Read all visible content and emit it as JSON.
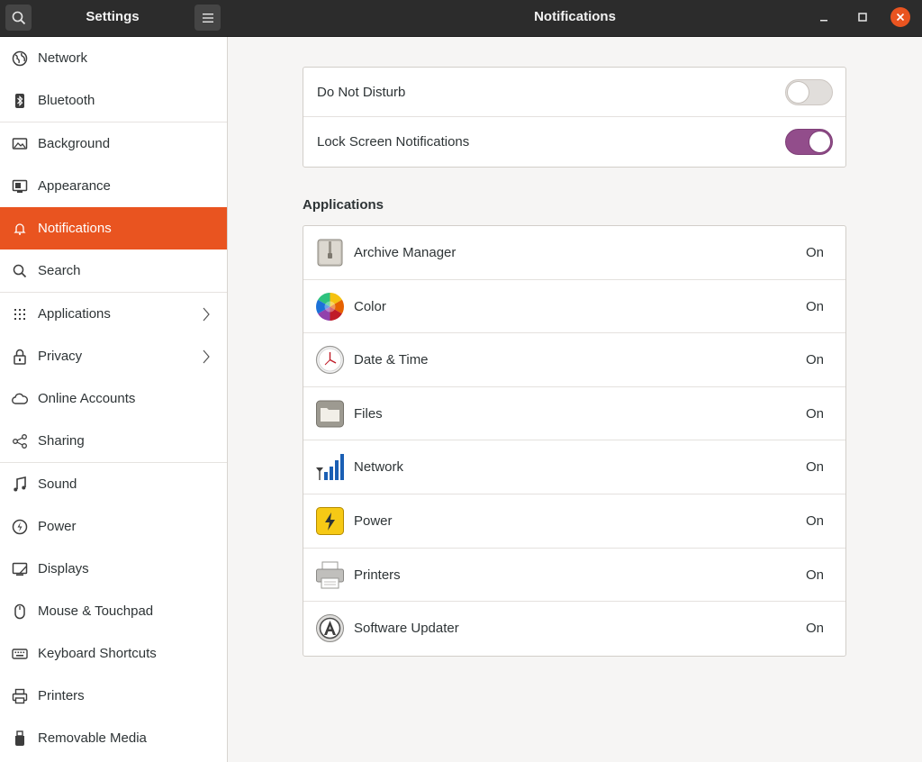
{
  "window": {
    "sidebar_title": "Settings",
    "main_title": "Notifications",
    "accent_color": "#e95420"
  },
  "sidebar": {
    "items": [
      {
        "label": "Network",
        "icon": "network-globe-icon"
      },
      {
        "label": "Bluetooth",
        "icon": "bluetooth-icon"
      },
      {
        "label": "Background",
        "icon": "background-icon"
      },
      {
        "label": "Appearance",
        "icon": "appearance-icon"
      },
      {
        "label": "Notifications",
        "icon": "bell-icon",
        "active": true
      },
      {
        "label": "Search",
        "icon": "search-icon"
      },
      {
        "label": "Applications",
        "icon": "grid-icon",
        "chevron": true
      },
      {
        "label": "Privacy",
        "icon": "lock-icon",
        "chevron": true
      },
      {
        "label": "Online Accounts",
        "icon": "cloud-icon"
      },
      {
        "label": "Sharing",
        "icon": "share-icon"
      },
      {
        "label": "Sound",
        "icon": "music-note-icon"
      },
      {
        "label": "Power",
        "icon": "power-icon"
      },
      {
        "label": "Displays",
        "icon": "display-icon"
      },
      {
        "label": "Mouse & Touchpad",
        "icon": "mouse-icon"
      },
      {
        "label": "Keyboard Shortcuts",
        "icon": "keyboard-icon"
      },
      {
        "label": "Printers",
        "icon": "printer-icon"
      },
      {
        "label": "Removable Media",
        "icon": "usb-drive-icon"
      }
    ]
  },
  "settings": {
    "do_not_disturb": {
      "label": "Do Not Disturb",
      "enabled": false
    },
    "lock_screen": {
      "label": "Lock Screen Notifications",
      "enabled": true
    },
    "toggle_on_color": "#924d8b"
  },
  "applications": {
    "title": "Applications",
    "items": [
      {
        "name": "Archive Manager",
        "state": "On",
        "icon": "archive-manager-icon"
      },
      {
        "name": "Color",
        "state": "On",
        "icon": "color-wheel-icon"
      },
      {
        "name": "Date & Time",
        "state": "On",
        "icon": "clock-icon"
      },
      {
        "name": "Files",
        "state": "On",
        "icon": "files-folder-icon"
      },
      {
        "name": "Network",
        "state": "On",
        "icon": "network-signal-icon"
      },
      {
        "name": "Power",
        "state": "On",
        "icon": "power-bolt-icon"
      },
      {
        "name": "Printers",
        "state": "On",
        "icon": "printer-app-icon"
      },
      {
        "name": "Software Updater",
        "state": "On",
        "icon": "software-updater-icon"
      }
    ]
  }
}
